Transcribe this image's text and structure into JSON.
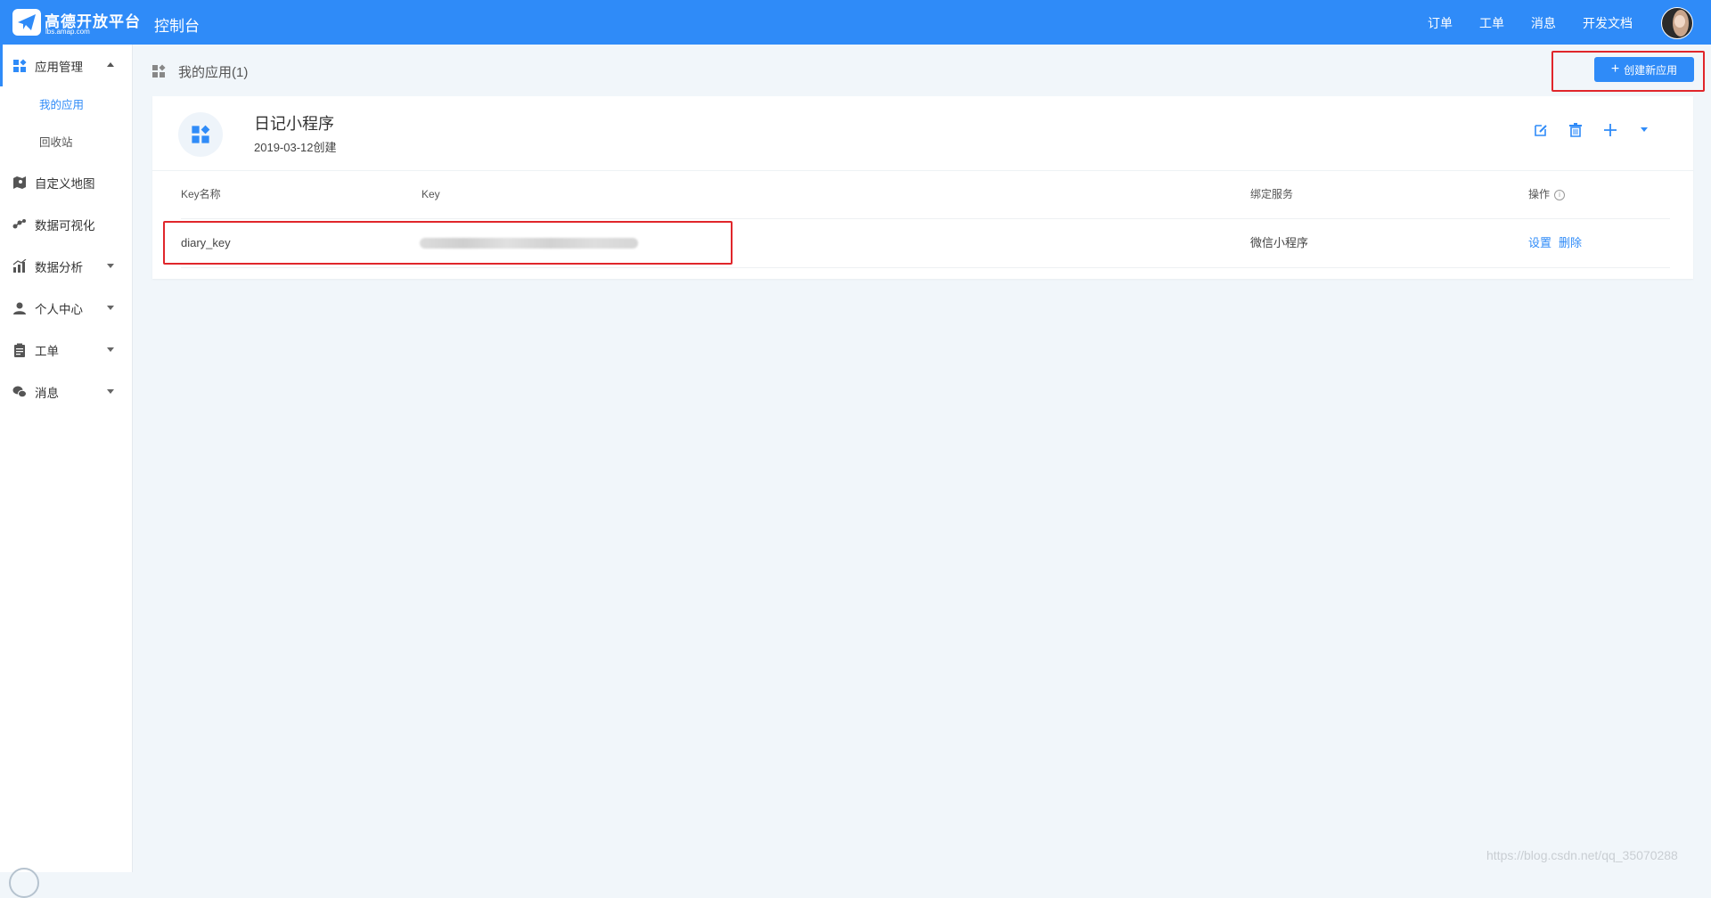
{
  "header": {
    "logo_text": "高德开放平台",
    "logo_sub": "lbs.amap.com",
    "console_title": "控制台",
    "nav": [
      "订单",
      "工单",
      "消息",
      "开发文档"
    ]
  },
  "sidebar": {
    "items": [
      {
        "label": "应用管理",
        "icon": "apps-icon",
        "expanded": true
      },
      {
        "label": "自定义地图",
        "icon": "map-icon"
      },
      {
        "label": "数据可视化",
        "icon": "visualization-icon"
      },
      {
        "label": "数据分析",
        "icon": "analysis-icon"
      },
      {
        "label": "个人中心",
        "icon": "user-icon"
      },
      {
        "label": "工单",
        "icon": "clipboard-icon"
      },
      {
        "label": "消息",
        "icon": "chat-icon"
      }
    ],
    "subitems": [
      "我的应用",
      "回收站"
    ]
  },
  "main": {
    "breadcrumb": "我的应用(1)",
    "create_button": "创建新应用",
    "app": {
      "name": "日记小程序",
      "created": "2019-03-12创建"
    },
    "table": {
      "headers": [
        "Key名称",
        "Key",
        "绑定服务",
        "操作"
      ],
      "rows": [
        {
          "key_name": "diary_key",
          "service": "微信小程序",
          "actions": [
            "设置",
            "删除"
          ]
        }
      ]
    }
  },
  "watermark": "https://blog.csdn.net/qq_35070288",
  "colors": {
    "primary": "#2f8bf8",
    "highlight": "#e0262b",
    "background": "#f1f6fa"
  }
}
